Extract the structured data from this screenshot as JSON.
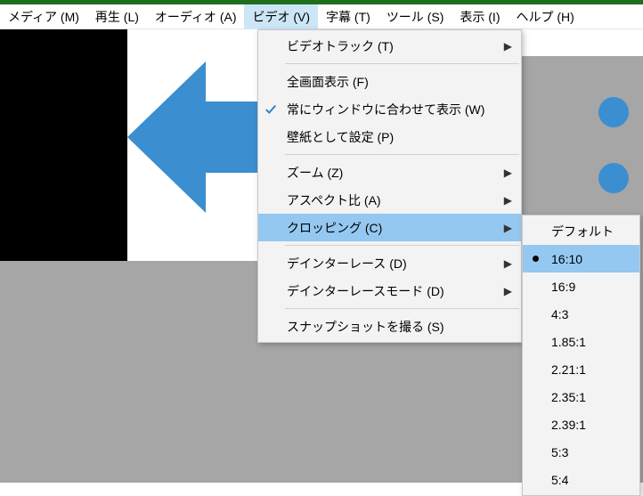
{
  "menubar": {
    "items": [
      {
        "label": "メディア (M)",
        "active": false
      },
      {
        "label": "再生 (L)",
        "active": false
      },
      {
        "label": "オーディオ (A)",
        "active": false
      },
      {
        "label": "ビデオ (V)",
        "active": true
      },
      {
        "label": "字幕 (T)",
        "active": false
      },
      {
        "label": "ツール (S)",
        "active": false
      },
      {
        "label": "表示 (I)",
        "active": false
      },
      {
        "label": "ヘルプ (H)",
        "active": false
      }
    ]
  },
  "video_menu": {
    "items": [
      {
        "label": "ビデオトラック (T)",
        "submenu": true,
        "checked": false,
        "highlight": false
      },
      {
        "separator": true
      },
      {
        "label": "全画面表示 (F)",
        "submenu": false,
        "checked": false,
        "highlight": false
      },
      {
        "label": "常にウィンドウに合わせて表示 (W)",
        "submenu": false,
        "checked": true,
        "highlight": false
      },
      {
        "label": "壁紙として設定 (P)",
        "submenu": false,
        "checked": false,
        "highlight": false
      },
      {
        "separator": true
      },
      {
        "label": "ズーム (Z)",
        "submenu": true,
        "checked": false,
        "highlight": false
      },
      {
        "label": "アスペクト比 (A)",
        "submenu": true,
        "checked": false,
        "highlight": false
      },
      {
        "label": "クロッピング (C)",
        "submenu": true,
        "checked": false,
        "highlight": true
      },
      {
        "separator": true
      },
      {
        "label": "デインターレース (D)",
        "submenu": true,
        "checked": false,
        "highlight": false
      },
      {
        "label": "デインターレースモード (D)",
        "submenu": true,
        "checked": false,
        "highlight": false
      },
      {
        "separator": true
      },
      {
        "label": "スナップショットを撮る (S)",
        "submenu": false,
        "checked": false,
        "highlight": false
      }
    ]
  },
  "crop_submenu": {
    "items": [
      {
        "label": "デフォルト",
        "selected": false,
        "highlight": false
      },
      {
        "label": "16:10",
        "selected": true,
        "highlight": true
      },
      {
        "label": "16:9",
        "selected": false,
        "highlight": false
      },
      {
        "label": "4:3",
        "selected": false,
        "highlight": false
      },
      {
        "label": "1.85:1",
        "selected": false,
        "highlight": false
      },
      {
        "label": "2.21:1",
        "selected": false,
        "highlight": false
      },
      {
        "label": "2.35:1",
        "selected": false,
        "highlight": false
      },
      {
        "label": "2.39:1",
        "selected": false,
        "highlight": false
      },
      {
        "label": "5:3",
        "selected": false,
        "highlight": false
      },
      {
        "label": "5:4",
        "selected": false,
        "highlight": false
      }
    ]
  },
  "icons": {
    "submenu_marker": "▶",
    "check_color": "#2a7fc8",
    "accent": "#3b8ecf"
  }
}
